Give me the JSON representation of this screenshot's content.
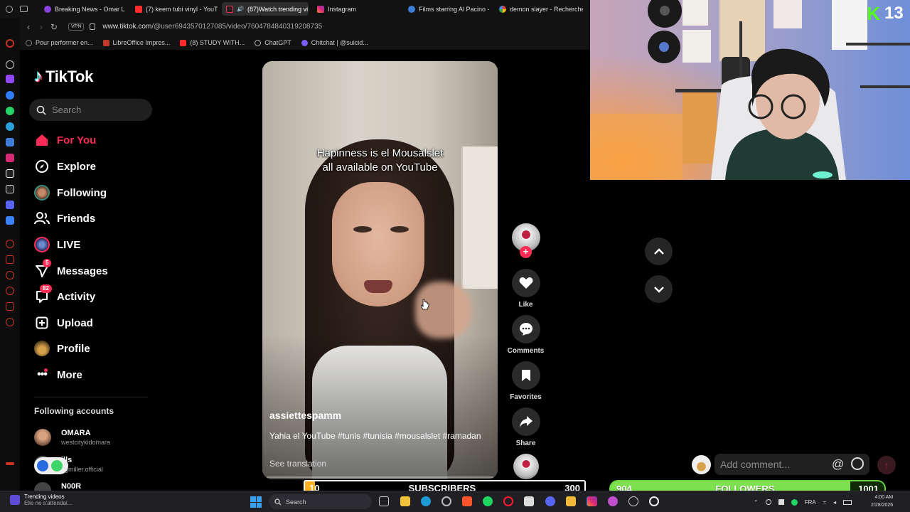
{
  "browser": {
    "tabs": [
      {
        "label": "Breaking News - Omar La",
        "color": "#8a43e0"
      },
      {
        "label": "(7) keem tubi vinyl - YouTu",
        "color": "#ff2a2a"
      },
      {
        "label": "(87)Watch trending vi",
        "color": "#fe2c55",
        "active": true
      },
      {
        "label": "Instagram",
        "color": "#e1306c"
      },
      {
        "label": "Films starring Al Pacino -",
        "color": "#3c7dd9"
      },
      {
        "label": "demon slayer - Recherche",
        "color": "#4285f4"
      }
    ],
    "url_host": "www.tiktok.com",
    "url_path": "/@user6943570127085/video/7604784840319208735",
    "vpn": "VPN",
    "bookmarks": [
      {
        "label": "Pour performer en...",
        "color": "#888"
      },
      {
        "label": "LibreOffice Impres...",
        "color": "#c0392b"
      },
      {
        "label": "(8) STUDY WITH...",
        "color": "#ff2a2a"
      },
      {
        "label": "ChatGPT",
        "color": "#bbb"
      },
      {
        "label": "Chitchat | @suicid...",
        "color": "#7c5cff"
      }
    ]
  },
  "tiktok": {
    "logo": "TikTok",
    "search_placeholder": "Search",
    "nav": [
      {
        "label": "For You",
        "icon": "home-icon",
        "active": true
      },
      {
        "label": "Explore",
        "icon": "compass-icon"
      },
      {
        "label": "Following",
        "icon": "following-avatar-icon"
      },
      {
        "label": "Friends",
        "icon": "friends-icon"
      },
      {
        "label": "LIVE",
        "icon": "live-avatar-icon"
      },
      {
        "label": "Messages",
        "icon": "send-icon",
        "badge": "5"
      },
      {
        "label": "Activity",
        "icon": "inbox-icon",
        "badge": "82"
      },
      {
        "label": "Upload",
        "icon": "plus-square-icon"
      },
      {
        "label": "Profile",
        "icon": "profile-avatar-icon"
      },
      {
        "label": "More",
        "icon": "more-dots-icon"
      }
    ],
    "following_title": "Following accounts",
    "accounts": [
      {
        "name": "OMARA",
        "handle": "westcitykidomara"
      },
      {
        "name": "ills",
        "handle": "egmiller.official"
      },
      {
        "name": "N00R",
        "handle": ""
      }
    ]
  },
  "video": {
    "caption_line1": "Hapinness is el Mousalslet",
    "caption_line2": "all available on YouTube",
    "author": "assiettespamm",
    "description": "Yahia el YouTube #tunis #tunisia #mousalslet #ramadan",
    "translate": "See translation"
  },
  "actions": {
    "like": "Like",
    "comments": "Comments",
    "favorites": "Favorites",
    "share": "Share"
  },
  "comment_input": {
    "placeholder": "Add comment..."
  },
  "stream": {
    "kick_count": "13",
    "subs_left": "10",
    "subs_label": "SUBSCRIBERS",
    "subs_right": "300",
    "subs_progress": 0.0,
    "followers_left": "904",
    "followers_label": "FOLLOWERS",
    "followers_right": "1001",
    "followers_progress": 0.9
  },
  "taskbar": {
    "notif_title": "Trending videos",
    "notif_sub": "Elle ne s'attendai...",
    "search": "Search",
    "lang": "FRA",
    "time": "4:00 AM",
    "date": "2/28/2026"
  },
  "colors": {
    "accent": "#fe2c55",
    "kick_green": "#53fc18"
  }
}
